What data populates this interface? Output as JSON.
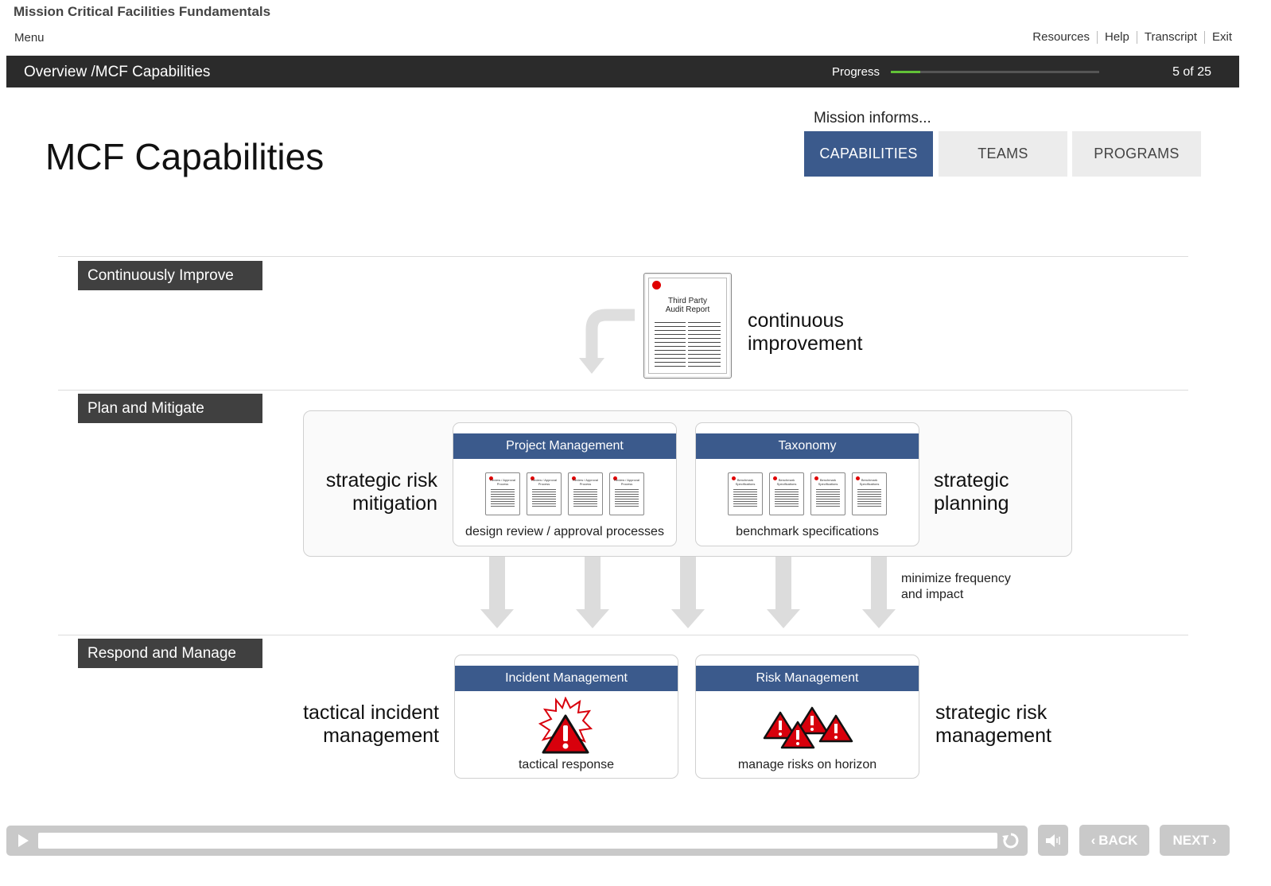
{
  "header": {
    "course_title": "Mission Critical Facilities Fundamentals",
    "menu": "Menu",
    "links": [
      "Resources",
      "Help",
      "Transcript",
      "Exit"
    ]
  },
  "topbar": {
    "breadcrumb": "Overview /MCF Capabilities",
    "progress_label": "Progress",
    "progress_fraction": 0.14,
    "page_count": "5 of 25"
  },
  "slide": {
    "title": "MCF Capabilities",
    "mission_label": "Mission informs...",
    "tabs": [
      {
        "label": "CAPABILITIES",
        "active": true
      },
      {
        "label": "TEAMS",
        "active": false
      },
      {
        "label": "PROGRAMS",
        "active": false
      }
    ],
    "sections": {
      "improve": "Continuously Improve",
      "plan": "Plan and Mitigate",
      "respond": "Respond and Manage"
    },
    "audit_doc": {
      "line1": "Third Party",
      "line2": "Audit Report"
    },
    "continuous_improvement": {
      "line1": "continuous",
      "line2": "improvement"
    },
    "strategic_risk_mitigation": {
      "line1": "strategic risk",
      "line2": "mitigation"
    },
    "strategic_planning": {
      "line1": "strategic",
      "line2": "planning"
    },
    "tactical_incident_management": {
      "line1": "tactical incident",
      "line2": "management"
    },
    "strategic_risk_management": {
      "line1": "strategic risk",
      "line2": "management"
    },
    "minimize": {
      "line1": "minimize frequency",
      "line2": "and impact"
    },
    "cards": {
      "project_management": {
        "title": "Project Management",
        "caption": "design review / approval processes",
        "doc_label": "Review / Approval Process"
      },
      "taxonomy": {
        "title": "Taxonomy",
        "caption": "benchmark specifications",
        "doc_label": "Benchmark Specifications"
      },
      "incident_management": {
        "title": "Incident Management",
        "caption": "tactical response"
      },
      "risk_management": {
        "title": "Risk Management",
        "caption": "manage risks on horizon"
      }
    }
  },
  "footer": {
    "back_label": "BACK",
    "next_label": "NEXT"
  },
  "colors": {
    "accent": "#3b5a8c",
    "progress": "#62c238",
    "alert_red": "#d8000c"
  }
}
